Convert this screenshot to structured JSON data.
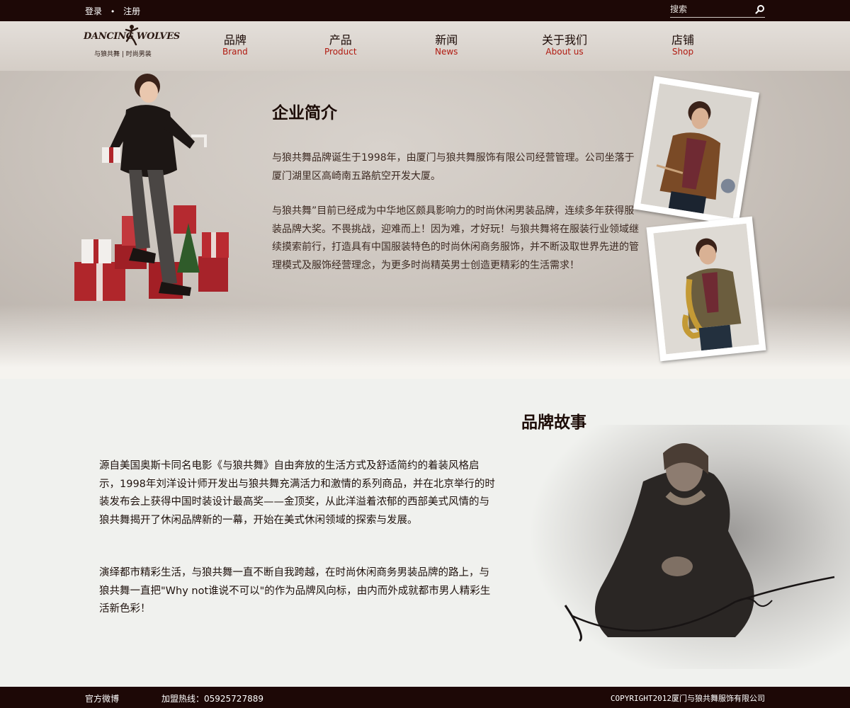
{
  "top": {
    "login": "登录",
    "separator": "•",
    "register": "注册",
    "search_placeholder": "搜索"
  },
  "logo": {
    "brand": "DANCING WOLVES",
    "tagline": "与狼共舞 | 时尚男装"
  },
  "nav": [
    {
      "zh": "品牌",
      "en": "Brand"
    },
    {
      "zh": "产品",
      "en": "Product"
    },
    {
      "zh": "新闻",
      "en": "News"
    },
    {
      "zh": "关于我们",
      "en": "About us"
    },
    {
      "zh": "店铺",
      "en": "Shop"
    }
  ],
  "intro": {
    "title": "企业简介",
    "p1": "与狼共舞品牌诞生于1998年，由厦门与狼共舞服饰有限公司经营管理。公司坐落于厦门湖里区高崎南五路航空开发大厦。",
    "p2": "与狼共舞”目前已经成为中华地区颇具影响力的时尚休闲男装品牌，连续多年获得服装品牌大奖。不畏挑战，迎难而上！因为难，才好玩！与狼共舞将在服装行业领域继续摸索前行，打造具有中国服装特色的时尚休闲商务服饰，并不断汲取世界先进的管理模式及服饰经营理念，为更多时尚精英男士创造更精彩的生活需求！"
  },
  "story": {
    "title": "品牌故事",
    "p1": "源自美国奥斯卡同名电影《与狼共舞》自由奔放的生活方式及舒适简约的着装风格启示，1998年刘洋设计师开发出与狼共舞充满活力和激情的系列商品，并在北京举行的时装发布会上获得中国时装设计最高奖——金顶奖，从此洋溢着浓郁的西部美式风情的与狼共舞揭开了休闲品牌新的一幕，开始在美式休闲领域的探索与发展。",
    "p2": "演绎都市精彩生活，与狼共舞一直不断自我跨越，在时尚休闲商务男装品牌的路上，与狼共舞一直把\"Why not谁说不可以\"的作为品牌风向标，由内而外成就都市男人精彩生活新色彩！"
  },
  "footer": {
    "weibo": "官方微博",
    "hotline": "加盟热线：05925727889",
    "copyright": "COPYRIGHT2012厦门与狼共舞服饰有限公司"
  },
  "colors": {
    "dark_bar": "#1d0806",
    "nav_en": "#b1190f",
    "heading": "#1c0b06"
  }
}
